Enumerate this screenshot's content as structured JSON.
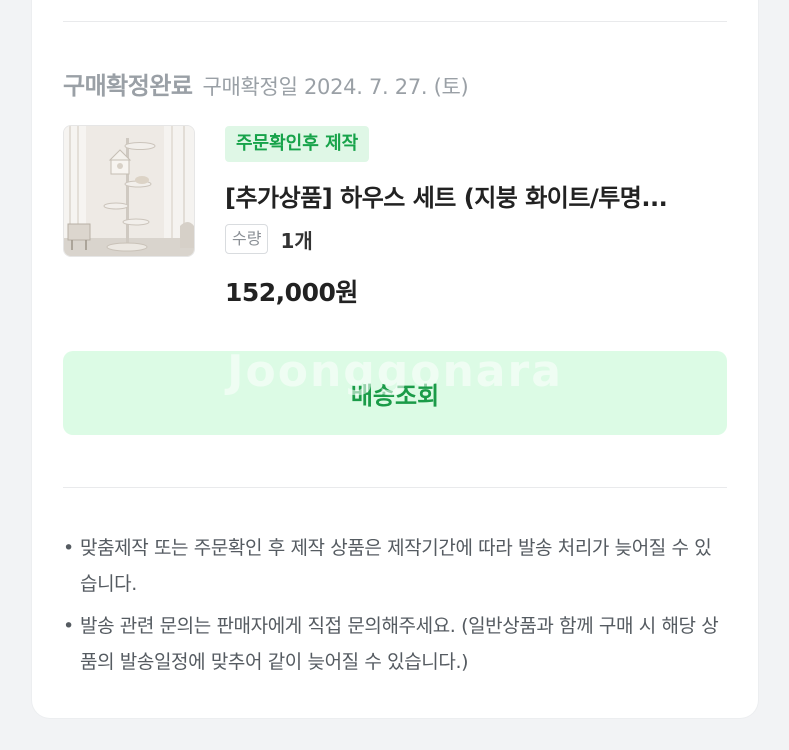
{
  "order": {
    "status_title": "구매확정완료",
    "confirm_date": "구매확정일 2024. 7. 27. (토)",
    "product": {
      "badge": "주문확인후 제작",
      "name": "[추가상품] 하우스 세트 (지붕 화이트/투명...",
      "qty_label": "수량",
      "qty_value": "1개",
      "price": "152,000원",
      "thumbnail_icon": "cat-tower-image"
    },
    "watermark": "Joonggonara",
    "delivery_button": "배송조회"
  },
  "notes": [
    "맞춤제작 또는 주문확인 후 제작 상품은 제작기간에 따라 발송 처리가 늦어질 수 있습니다.",
    "발송 관련 문의는 판매자에게 직접 문의해주세요. (일반상품과 함께 구매 시 해당 상품의 발송일정에 맞추어 같이 늦어질 수 있습니다.)"
  ],
  "colors": {
    "accent_green": "#1a9b48",
    "button_bg": "#dcfbe5",
    "badge_bg": "#dff7e6"
  }
}
